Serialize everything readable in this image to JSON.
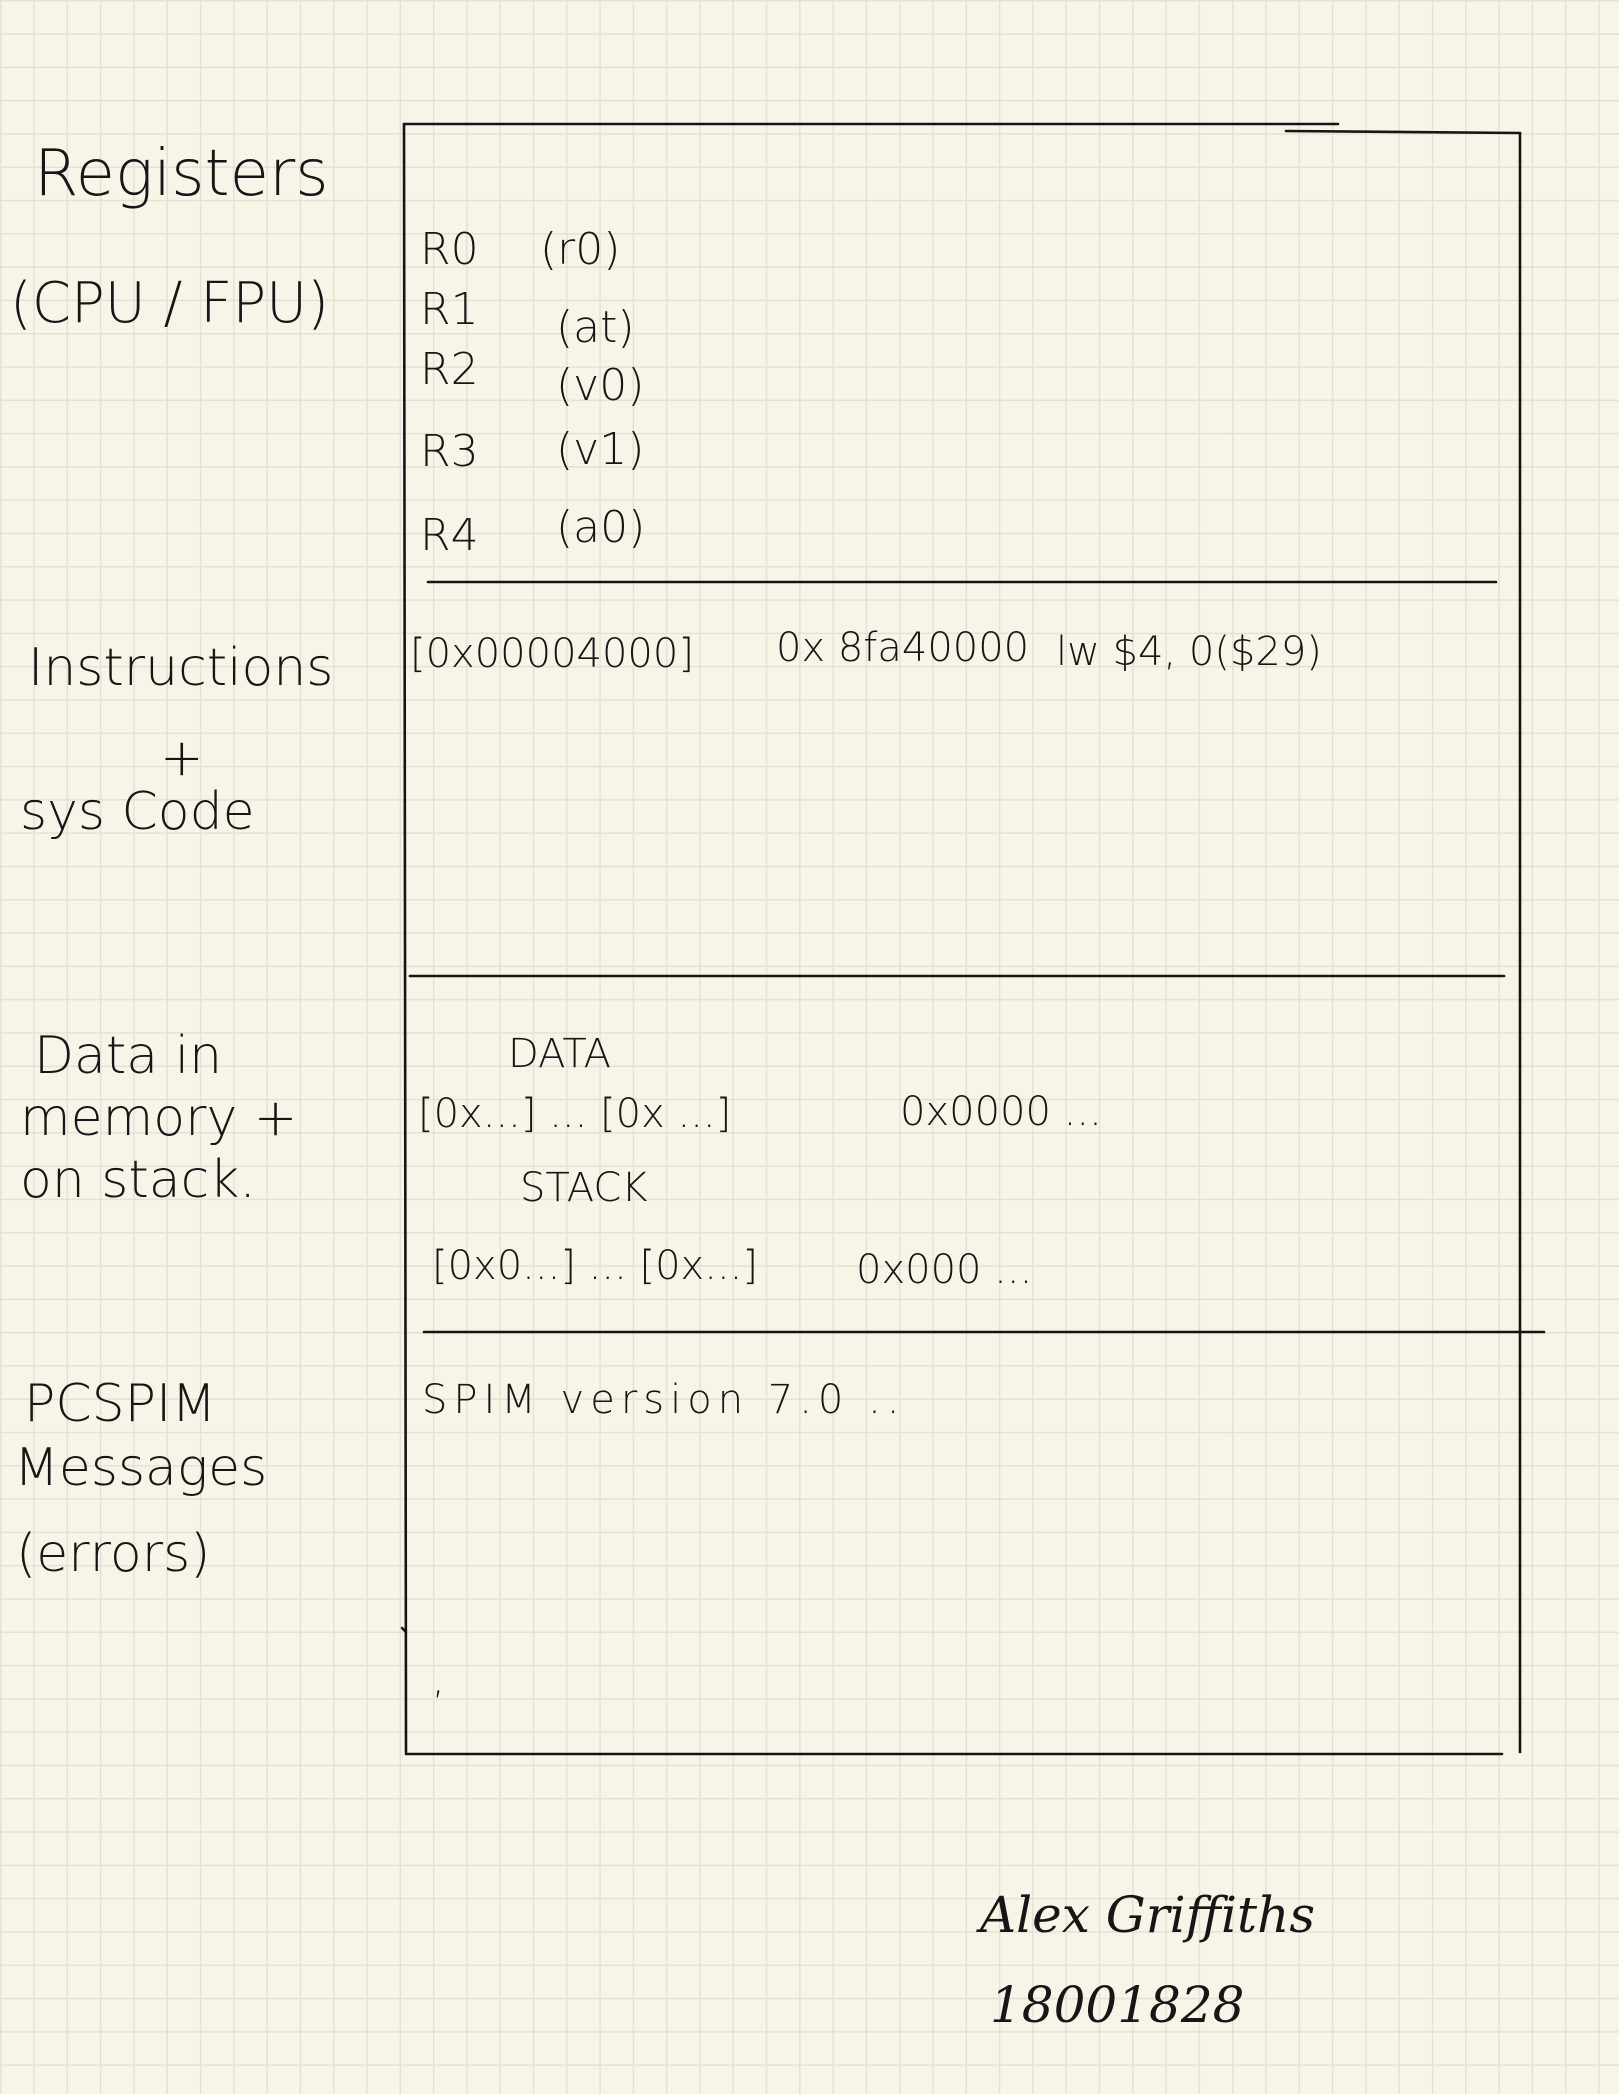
{
  "side_labels": {
    "registers": [
      "Registers",
      "(CPU / FPU)"
    ],
    "instructions": [
      "Instructions",
      "+",
      "sys Code"
    ],
    "data": [
      "Data in",
      "memory +",
      "on stack."
    ],
    "messages": [
      "PCSPIM",
      "Messages",
      "(errors)"
    ]
  },
  "registers": [
    {
      "name": "R0",
      "alias": "(r0)"
    },
    {
      "name": "R1",
      "alias": "(at)"
    },
    {
      "name": "R2",
      "alias": "(v0)"
    },
    {
      "name": "R3",
      "alias": "(v1)"
    },
    {
      "name": "R4",
      "alias": "(a0)"
    }
  ],
  "instruction_line": {
    "address": "[0x00004000]",
    "code": "0x 8fa40000",
    "asm": "lw $4, 0($29)"
  },
  "data_section": {
    "data_heading": "DATA",
    "data_row": {
      "range": "[0x...] ... [0x ...]",
      "value": "0x0000 ..."
    },
    "stack_heading": "STACK",
    "stack_row": {
      "range": "[0x0...] ... [0x...]",
      "value": "0x000 ..."
    }
  },
  "messages_section": {
    "line": "SPIM version 7.0 ..",
    "cursor": ","
  },
  "signature": {
    "name": "Alex Griffiths",
    "number": "18001828"
  }
}
